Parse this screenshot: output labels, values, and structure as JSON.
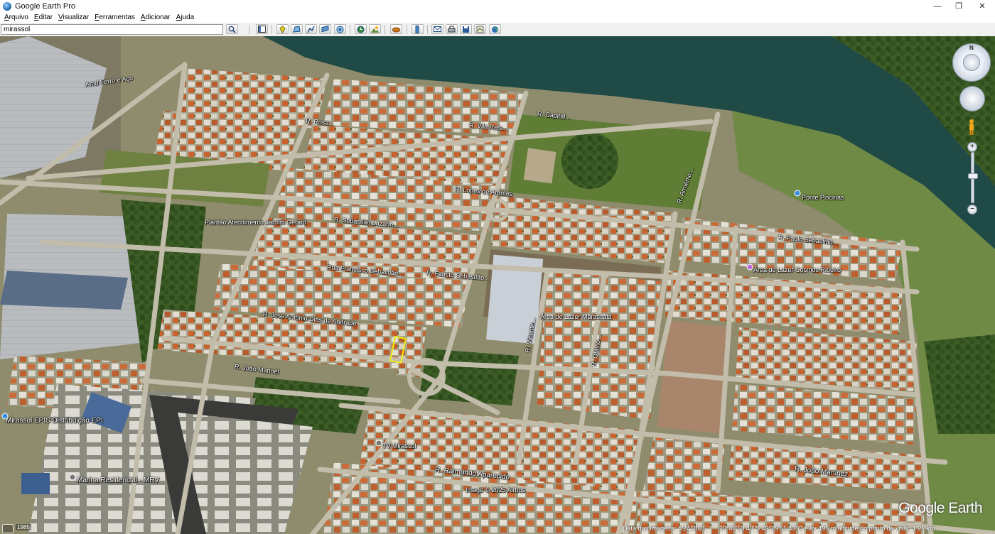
{
  "window": {
    "title": "Google Earth Pro",
    "minimize": "—",
    "maximize": "❐",
    "close": "✕"
  },
  "menu": [
    "Arquivo",
    "Editar",
    "Visualizar",
    "Ferramentas",
    "Adicionar",
    "Ajuda"
  ],
  "search": {
    "value": "mirassol"
  },
  "map": {
    "labels": {
      "amd_ferro": "Amd Ferro e Aço",
      "rua_capital": "R. Capital...",
      "vila_reis": "R. Vila Reis...",
      "rua_rosa": "R. Rosa...",
      "rua_sebastiao": "R. Lopes de Arantes",
      "plantao": "Plantão Atendimento Jardim Gerard",
      "rua_1": "R. Sebastião Lazarin...",
      "rua_2": "Rua Francisco Sebastião...",
      "rua_3": "R. Fausto Sebastião...",
      "rua_4": "R. José Antônio Dias de Andrade",
      "rua_joao_manoel": "R. João Manoel",
      "area_lazer": "Área de Lazer Marassaia",
      "r_vasconc": "R. Vicente...",
      "r_otavio": "R. Otávio...",
      "ponte_piscinas": "Ponte Piscinas",
      "rua_5": "R. Paulo Sebastião...",
      "area_lazer_2": "Área de Lazer Cosmos Ribeiro",
      "r_ameciano": "R. Armênio...",
      "mirassol_epis": "Mirassol EPIS Distribuição EPI",
      "tv_mirassol": "TV Mirassol",
      "r_raimundo": "R. Raimundo Aparecido",
      "image_credit": "Image © 2025 Airbus",
      "mrv": "Marina Residencial - MRV",
      "r_joao_martinez": "R. João Martinez"
    },
    "logo": "Google Earth"
  },
  "status": {
    "year": "1985",
    "date": "Data das imagens: 4/24/2025",
    "coords": "20°47'53.43\"S  49°29'51.43\"O  elev 495 m  altitude do ponto de visão 1.21 km"
  },
  "nav": {
    "north": "N",
    "zoom_in": "+",
    "zoom_out": "−"
  }
}
